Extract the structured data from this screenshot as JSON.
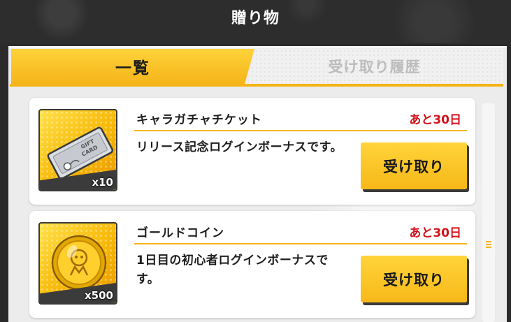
{
  "header": {
    "title": "贈り物"
  },
  "tabs": [
    {
      "label": "一覧",
      "active": true
    },
    {
      "label": "受け取り履歴",
      "active": false
    }
  ],
  "gifts": [
    {
      "name": "キャラガチャチケット",
      "expiry": "あと30日",
      "description": "リリース記念ログインボーナスです。",
      "quantity": "x10",
      "icon": "gift-card-ticket-icon",
      "button_label": "受け取り"
    },
    {
      "name": "ゴールドコイン",
      "expiry": "あと30日",
      "description": "1日目の初心者ログインボーナスです。",
      "quantity": "x500",
      "icon": "gold-coin-icon",
      "button_label": "受け取り"
    }
  ],
  "colors": {
    "accent": "#f5b51a",
    "expiry": "#d3131c",
    "header_bg": "#2d2d2d",
    "panel_bg": "#ececec"
  }
}
